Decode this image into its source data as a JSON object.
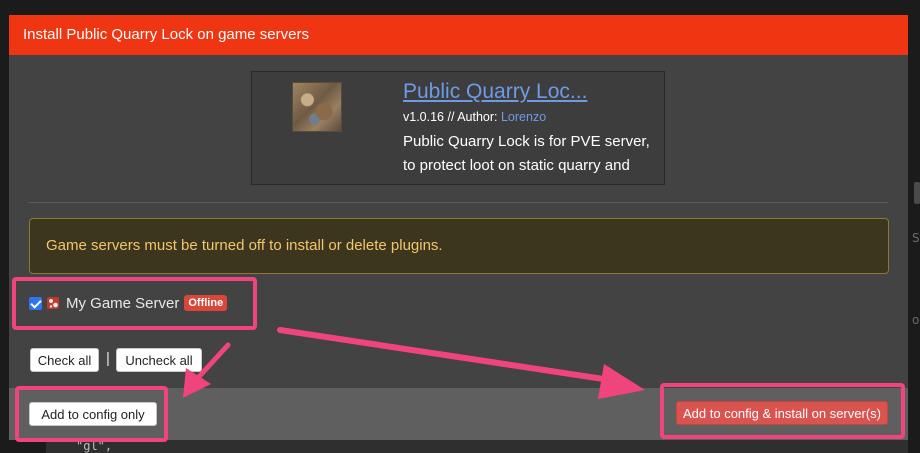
{
  "dialog": {
    "title": "Install Public Quarry Lock on game servers"
  },
  "plugin": {
    "name": "Public Quarry Loc...",
    "version_author_prefix": "v1.0.16 // Author: ",
    "author": "Lorenzo",
    "description": "Public Quarry Lock is for PVE server, to protect loot on static quarry and",
    "thumbnail_icon": "plugin-thumbnail"
  },
  "warning": {
    "text": "Game servers must be turned off to install or delete plugins."
  },
  "servers": [
    {
      "name": "My Game Server",
      "status": "Offline",
      "checked": true,
      "game_icon": "rust-game-icon"
    }
  ],
  "actions": {
    "check_all": "Check all",
    "separator": "|",
    "uncheck_all": "Uncheck all",
    "add_config_only": "Add to config only",
    "add_and_install": "Add to config & install on server(s)"
  },
  "background": {
    "fragment_text": "\"gl\","
  },
  "colors": {
    "header": "#ef3511",
    "modal_body": "#434343",
    "footer": "#5f5f5f",
    "link": "#6f9ae6",
    "warning_text": "#f3c66b",
    "warning_border": "#8b7a2f",
    "danger_button": "#d9534f",
    "annotation": "#f0457c"
  }
}
